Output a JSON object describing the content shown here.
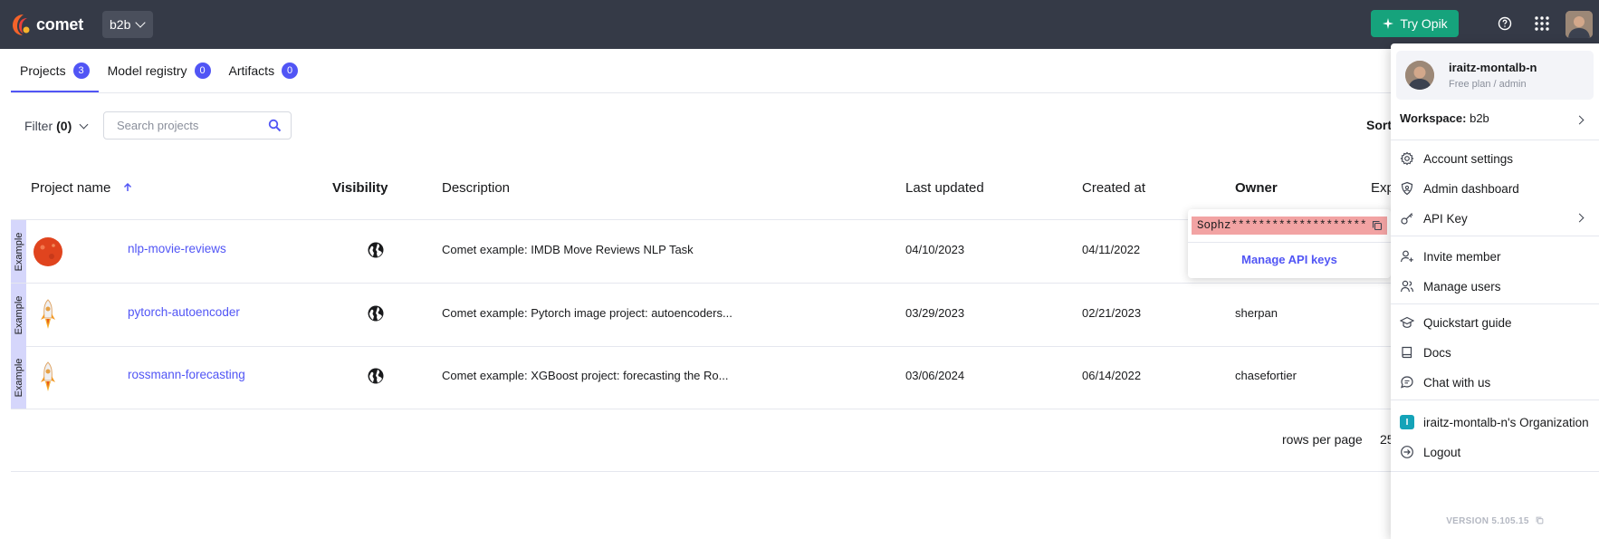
{
  "header": {
    "brand": "comet",
    "workspace": "b2b",
    "try_opik": "Try Opik"
  },
  "tabs": [
    {
      "label": "Projects",
      "count": "3"
    },
    {
      "label": "Model registry",
      "count": "0"
    },
    {
      "label": "Artifacts",
      "count": "0"
    }
  ],
  "toolbar": {
    "filter_label": "Filter",
    "filter_count": "(0)",
    "search_placeholder": "Search projects",
    "sort_label": "Sort"
  },
  "table": {
    "columns": [
      "Project name",
      "Visibility",
      "Description",
      "Last updated",
      "Created at",
      "Owner",
      "Exp"
    ],
    "rows": [
      {
        "tag": "Example",
        "name": "nlp-movie-reviews",
        "description": "Comet example: IMDB Move Reviews NLP Task",
        "last_updated": "04/10/2023",
        "created_at": "04/11/2022",
        "owner": ""
      },
      {
        "tag": "Example",
        "name": "pytorch-autoencoder",
        "description": "Comet example: Pytorch image project: autoencoders...",
        "last_updated": "03/29/2023",
        "created_at": "02/21/2023",
        "owner": "sherpan"
      },
      {
        "tag": "Example",
        "name": "rossmann-forecasting",
        "description": "Comet example: XGBoost project: forecasting the Ro...",
        "last_updated": "03/06/2024",
        "created_at": "06/14/2022",
        "owner": "chasefortier"
      }
    ]
  },
  "pagination": {
    "rows_per_page_label": "rows per page",
    "rows_per_page_value": "25"
  },
  "api_popup": {
    "key": "Sophz********************",
    "manage_label": "Manage API keys"
  },
  "user_menu": {
    "username": "iraitz-montalb-n",
    "plan": "Free plan / admin",
    "workspace_label": "Workspace:",
    "workspace_value": "b2b",
    "items": {
      "account_settings": "Account settings",
      "admin_dashboard": "Admin dashboard",
      "api_key": "API Key",
      "invite_member": "Invite member",
      "manage_users": "Manage users",
      "quickstart": "Quickstart guide",
      "docs": "Docs",
      "chat": "Chat with us",
      "organization": "iraitz-montalb-n's Organization",
      "org_initial": "I",
      "logout": "Logout"
    },
    "version": "VERSION 5.105.15"
  },
  "colors": {
    "topbar": "#353a47",
    "accent": "#5155f5",
    "opik_green": "#16a37c",
    "example_tag": "#d5d6fb",
    "api_key_highlight": "#f2a3a3"
  }
}
